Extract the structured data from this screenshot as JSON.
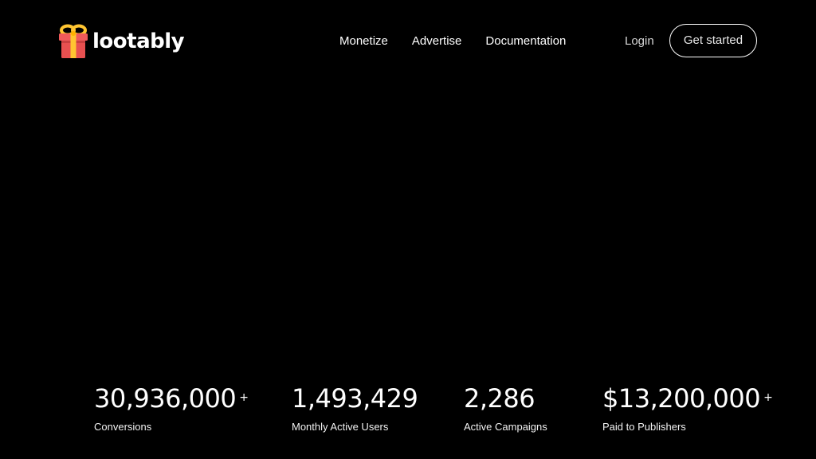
{
  "brand": {
    "name": "lootably",
    "icon": "gift-icon",
    "colors": {
      "box": "#f05a5a",
      "ribbon": "#ffc531",
      "shade": "#d64545"
    }
  },
  "nav": {
    "items": [
      {
        "label": "Monetize"
      },
      {
        "label": "Advertise"
      },
      {
        "label": "Documentation"
      }
    ],
    "login_label": "Login",
    "cta_label": "Get started"
  },
  "stats": [
    {
      "value": "30,936,000",
      "suffix": "+",
      "label": "Conversions"
    },
    {
      "value": "1,493,429",
      "suffix": "",
      "label": "Monthly Active Users"
    },
    {
      "value": "2,286",
      "suffix": "",
      "label": "Active Campaigns"
    },
    {
      "value": "$13,200,000",
      "suffix": "+",
      "label": "Paid to Publishers"
    }
  ],
  "theme": {
    "background": "#000000",
    "text": "#ffffff"
  }
}
